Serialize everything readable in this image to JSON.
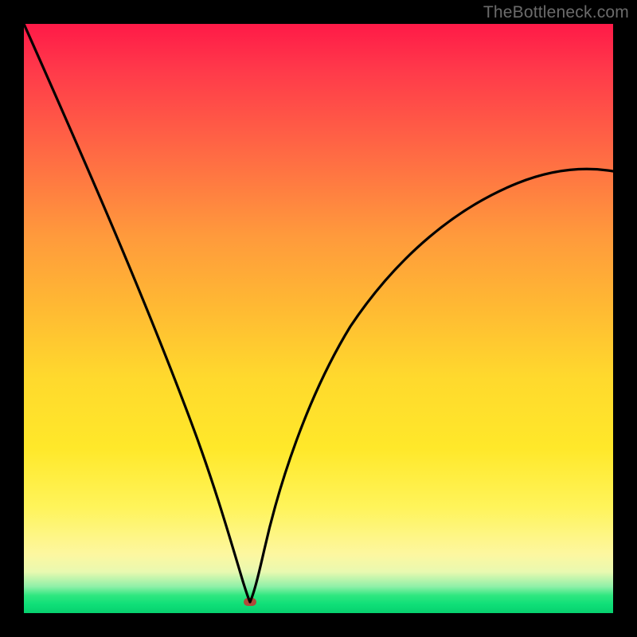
{
  "watermark": "TheBottleneck.com",
  "chart_data": {
    "type": "line",
    "title": "",
    "xlabel": "",
    "ylabel": "",
    "xlim": [
      0,
      100
    ],
    "ylim": [
      0,
      100
    ],
    "grid": false,
    "legend": false,
    "background": {
      "type": "vertical-gradient",
      "stops": [
        {
          "pos": 0,
          "color": "#ff1a48"
        },
        {
          "pos": 50,
          "color": "#ffc030"
        },
        {
          "pos": 85,
          "color": "#fff45a"
        },
        {
          "pos": 97,
          "color": "#2fe780"
        },
        {
          "pos": 100,
          "color": "#07d06e"
        }
      ]
    },
    "minimum_marker": {
      "x": 38,
      "y": 2,
      "color": "#b04a3a",
      "shape": "pill"
    },
    "series": [
      {
        "name": "left-branch",
        "x": [
          0,
          4,
          8,
          12,
          16,
          20,
          24,
          28,
          32,
          34,
          36,
          37,
          38
        ],
        "values": [
          100,
          90,
          80,
          70,
          60,
          48,
          36,
          25,
          14,
          9,
          5,
          3,
          2
        ]
      },
      {
        "name": "right-branch",
        "x": [
          38,
          39,
          40,
          42,
          44,
          48,
          52,
          58,
          64,
          72,
          80,
          90,
          100
        ],
        "values": [
          2,
          4,
          7,
          13,
          19,
          29,
          37,
          46,
          53,
          60,
          65,
          71,
          75
        ]
      }
    ]
  }
}
